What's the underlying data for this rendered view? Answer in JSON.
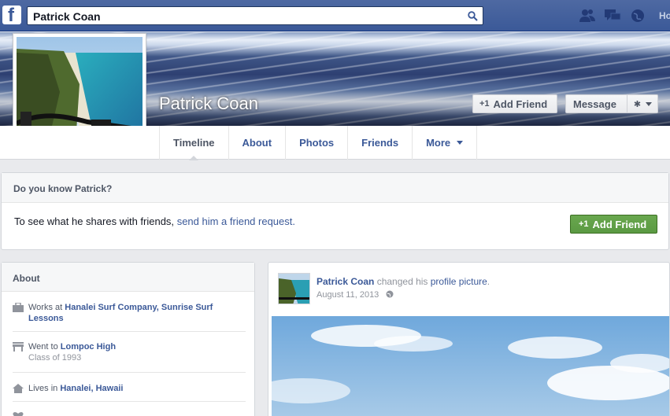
{
  "topbar": {
    "logo": "f",
    "search_value": "Patrick Coan",
    "right_clip": "Ho",
    "icons": [
      "friends-icon",
      "messages-icon",
      "globe-icon",
      "search-icon"
    ]
  },
  "profile": {
    "name": "Patrick Coan",
    "add_friend_label": "Add Friend",
    "message_label": "Message"
  },
  "nav": {
    "tabs": [
      {
        "label": "Timeline"
      },
      {
        "label": "About"
      },
      {
        "label": "Photos"
      },
      {
        "label": "Friends"
      },
      {
        "label": "More"
      }
    ]
  },
  "know_box": {
    "title": "Do you know Patrick?",
    "text": "To see what he shares with friends,",
    "link": "send him a friend request.",
    "button": "Add Friend"
  },
  "about": {
    "title": "About",
    "items": [
      {
        "prefix": "Works at ",
        "link": "Hanalei Surf Company, Sunrise Surf Lessons",
        "sub": ""
      },
      {
        "prefix": "Went to ",
        "link": "Lompoc High",
        "sub": "Class of 1993"
      },
      {
        "prefix": "Lives in ",
        "link": "Hanalei, Hawaii",
        "sub": ""
      }
    ]
  },
  "post": {
    "author": "Patrick Coan",
    "action": " changed his ",
    "object": "profile picture",
    "end": ".",
    "date": "August 11, 2013"
  },
  "colors": {
    "brand_blue": "#3b5998",
    "green_button": "#5b9a43",
    "page_bg": "#e9eaed"
  }
}
